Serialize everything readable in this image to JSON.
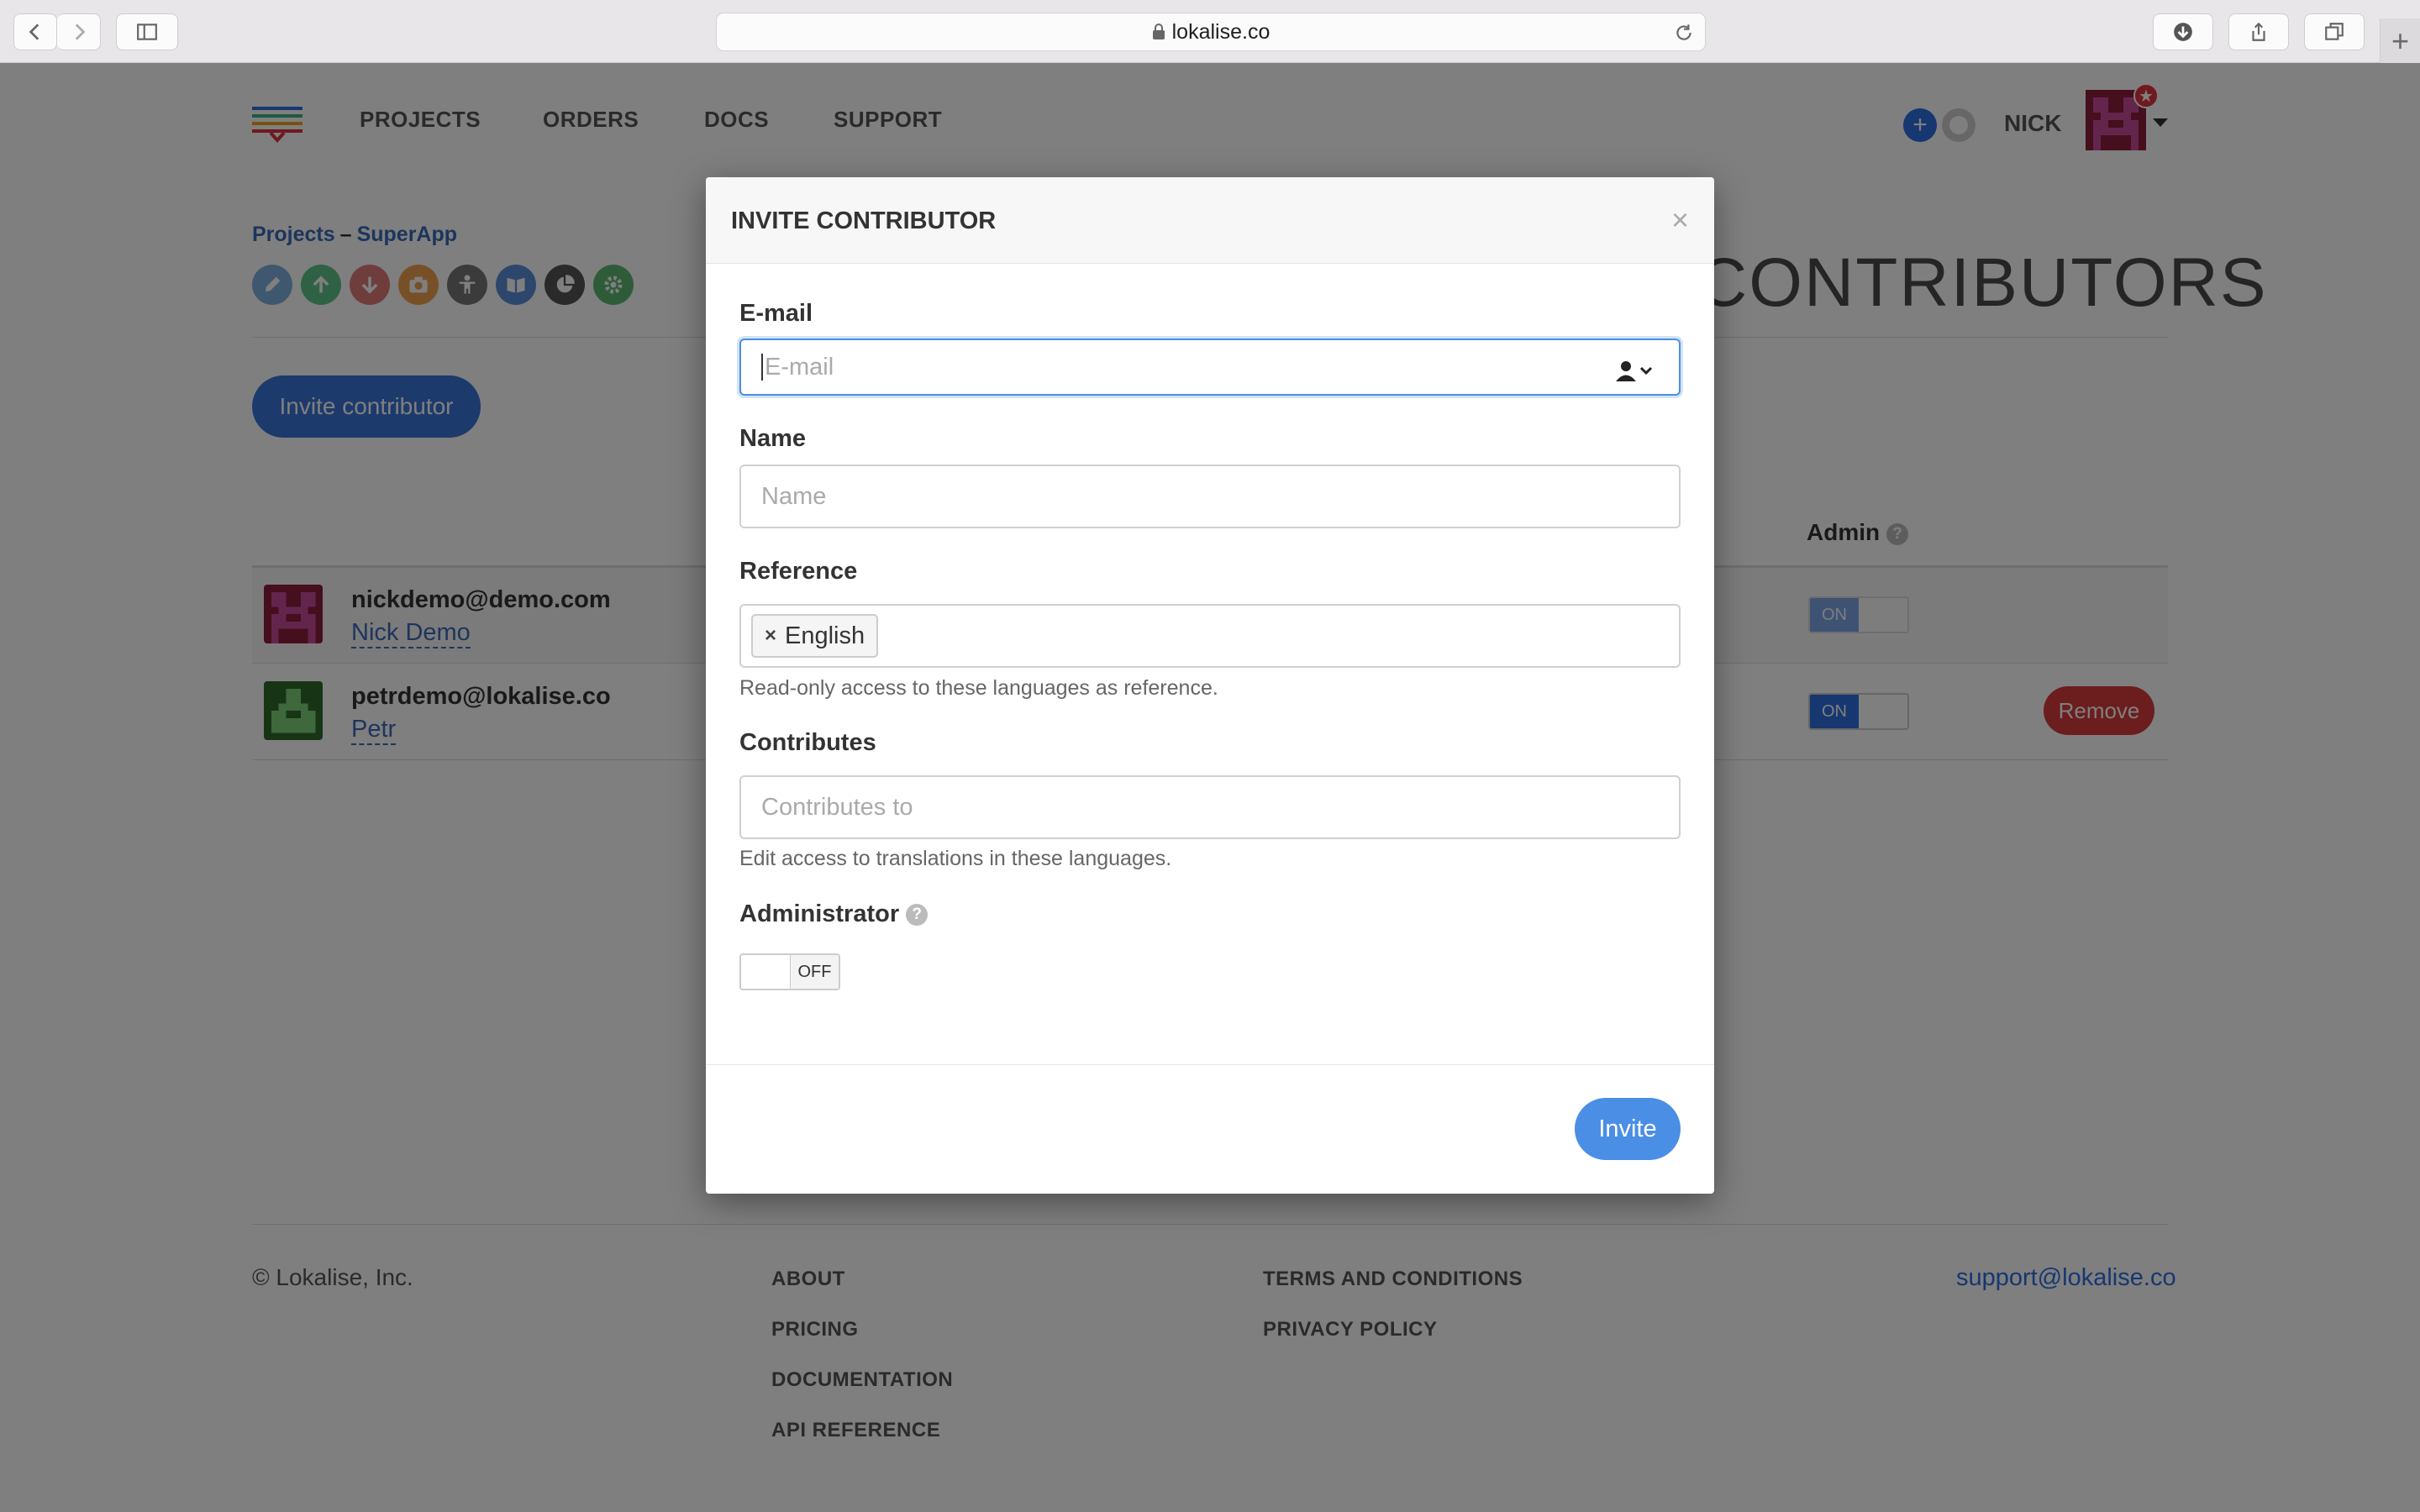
{
  "browser": {
    "url": "lokalise.co"
  },
  "nav": {
    "links": [
      "PROJECTS",
      "ORDERS",
      "DOCS",
      "SUPPORT"
    ],
    "user": "NICK",
    "badge": "★"
  },
  "breadcrumb": {
    "root": "Projects",
    "separator": "–",
    "project": "SuperApp"
  },
  "page": {
    "heading": "CONTRIBUTORS",
    "invite_button": "Invite contributor",
    "admin_header": "Admin",
    "help_mark": "?"
  },
  "contributors": [
    {
      "email": "nickdemo@demo.com",
      "name": "Nick Demo",
      "admin": "ON"
    },
    {
      "email": "petrdemo@lokalise.co",
      "name": "Petr",
      "admin": "ON",
      "remove_label": "Remove"
    }
  ],
  "footer": {
    "copyright": "© Lokalise, Inc.",
    "col1": [
      "ABOUT",
      "PRICING",
      "DOCUMENTATION",
      "API REFERENCE"
    ],
    "col2": [
      "TERMS AND CONDITIONS",
      "PRIVACY POLICY"
    ],
    "support_email": "support@lokalise.co"
  },
  "modal": {
    "title": "INVITE CONTRIBUTOR",
    "close": "×",
    "email_label": "E-mail",
    "email_placeholder": "E-mail",
    "name_label": "Name",
    "name_placeholder": "Name",
    "reference_label": "Reference",
    "reference_tags": [
      "English"
    ],
    "reference_hint": "Read-only access to these languages as reference.",
    "contributes_label": "Contributes",
    "contributes_placeholder": "Contributes to",
    "contributes_hint": "Edit access to translations in these languages.",
    "admin_label": "Administrator",
    "admin_state": "OFF",
    "submit": "Invite"
  },
  "colors": {
    "primary": "#3a74d8",
    "danger": "#d93a3a",
    "link": "#3a6bb8"
  }
}
